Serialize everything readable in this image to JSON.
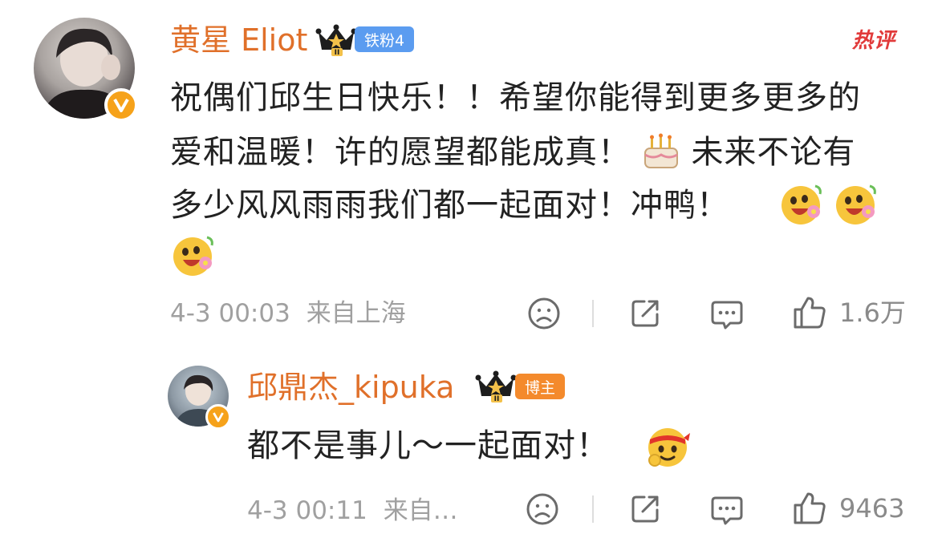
{
  "comment": {
    "username": "黄星 Eliot",
    "fan_badge": "铁粉4",
    "hot_label": "热评",
    "text_line1": "祝偶们邱生日快乐！！希望你能得到更多更多的",
    "text_line2a": "爱和温暖！许的愿望都能成真！",
    "text_line2b": "未来不论有",
    "text_line3": "多少风风雨雨我们都一起面对！冲鸭！",
    "timestamp": "4-3 00:03",
    "location": "来自上海",
    "like_count": "1.6万",
    "icons": [
      "avatar",
      "verified-badge-icon",
      "crown-icon",
      "cake-emoji",
      "flower-smile-emoji",
      "sad-face-icon",
      "share-icon",
      "comment-icon",
      "thumbs-up-icon"
    ]
  },
  "reply": {
    "username": "邱鼎杰_kipuka",
    "role_badge": "博主",
    "text": "都不是事儿～一起面对！",
    "timestamp": "4-3 00:11",
    "location": "来自…",
    "like_count": "9463",
    "icons": [
      "avatar",
      "verified-badge-icon",
      "crown-icon",
      "headband-emoji",
      "sad-face-icon",
      "share-icon",
      "comment-icon",
      "thumbs-up-icon"
    ]
  },
  "colors": {
    "username": "#e0702a",
    "fan_badge": "#5b9cf0",
    "host_badge": "#f48a2c",
    "hot": "#e13a3a",
    "meta": "#a0a0a0"
  }
}
